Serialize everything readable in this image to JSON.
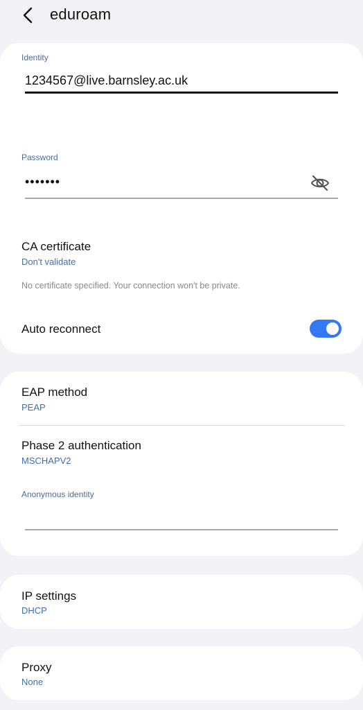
{
  "header": {
    "title": "eduroam"
  },
  "card1": {
    "identity_label": "Identity",
    "identity_value": "1234567@live.barnsley.ac.uk",
    "password_label": "Password",
    "password_value": "•••••••",
    "ca_cert_title": "CA certificate",
    "ca_cert_value": "Don't validate",
    "ca_cert_hint": "No certificate specified. Your connection won't be private.",
    "auto_reconnect_label": "Auto reconnect",
    "auto_reconnect_on": true
  },
  "card2": {
    "eap_title": "EAP method",
    "eap_value": "PEAP",
    "phase2_title": "Phase 2 authentication",
    "phase2_value": "MSCHAPV2",
    "anon_identity_label": "Anonymous identity",
    "anon_identity_value": ""
  },
  "card3": {
    "ip_title": "IP settings",
    "ip_value": "DHCP"
  },
  "card4": {
    "proxy_title": "Proxy",
    "proxy_value": "None"
  },
  "colors": {
    "accent": "#3478f6",
    "label_blue": "#4a6c9a",
    "value_blue": "#3d6fb0",
    "background": "#f3f3f7",
    "card": "#ffffff"
  },
  "icons": {
    "back": "chevron-left-icon",
    "password_visibility": "eye-off-icon"
  }
}
